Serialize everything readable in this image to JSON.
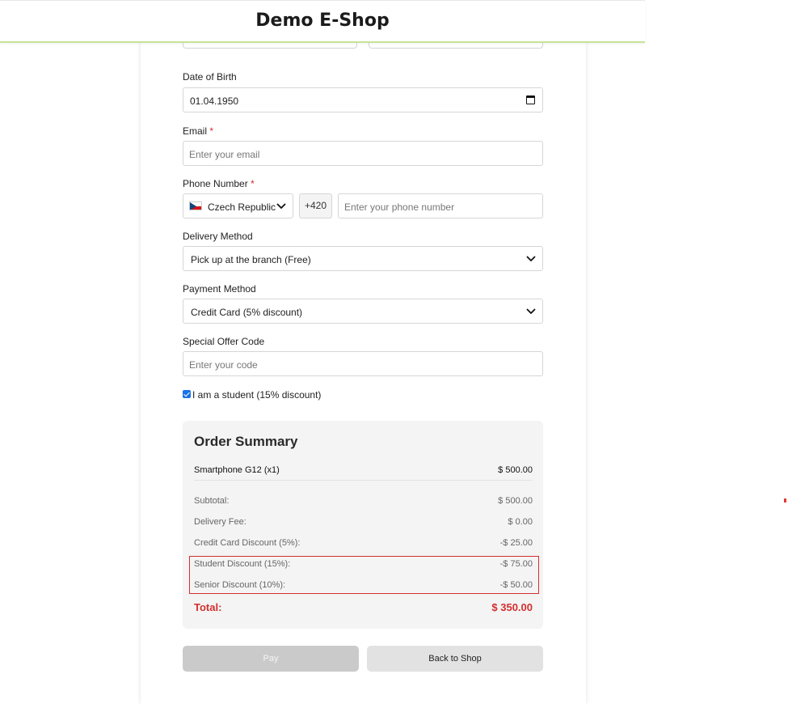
{
  "header": {
    "title": "Demo E-Shop"
  },
  "form": {
    "dob": {
      "label": "Date of Birth",
      "value": "01.04.1950"
    },
    "email": {
      "label": "Email",
      "required_mark": "*",
      "placeholder": "Enter your email"
    },
    "phone": {
      "label": "Phone Number",
      "required_mark": "*",
      "country": "Czech Republic",
      "prefix": "+420",
      "placeholder": "Enter your phone number"
    },
    "delivery": {
      "label": "Delivery Method",
      "value": "Pick up at the branch (Free)"
    },
    "payment": {
      "label": "Payment Method",
      "value": "Credit Card (5% discount)"
    },
    "offer": {
      "label": "Special Offer Code",
      "placeholder": "Enter your code"
    },
    "student": {
      "label": "I am a student (15% discount)",
      "checked": true
    }
  },
  "summary": {
    "title": "Order Summary",
    "item": {
      "name": "Smartphone G12 (x1)",
      "price": "$ 500.00"
    },
    "rows": [
      {
        "label": "Subtotal:",
        "value": "$ 500.00"
      },
      {
        "label": "Delivery Fee:",
        "value": "$ 0.00"
      },
      {
        "label": "Credit Card Discount (5%):",
        "value": "-$ 25.00"
      },
      {
        "label": "Student Discount (15%):",
        "value": "-$ 75.00"
      },
      {
        "label": "Senior Discount (10%):",
        "value": "-$ 50.00"
      }
    ],
    "total": {
      "label": "Total:",
      "value": "$ 350.00"
    }
  },
  "buttons": {
    "pay": "Pay",
    "back": "Back to Shop"
  },
  "colors": {
    "accent_red": "#d32f2f",
    "header_border": "#c7e39a",
    "checkbox_blue": "#1a73e8"
  },
  "icons": [
    "calendar-icon",
    "chevron-down-icon",
    "czech-flag-icon"
  ]
}
